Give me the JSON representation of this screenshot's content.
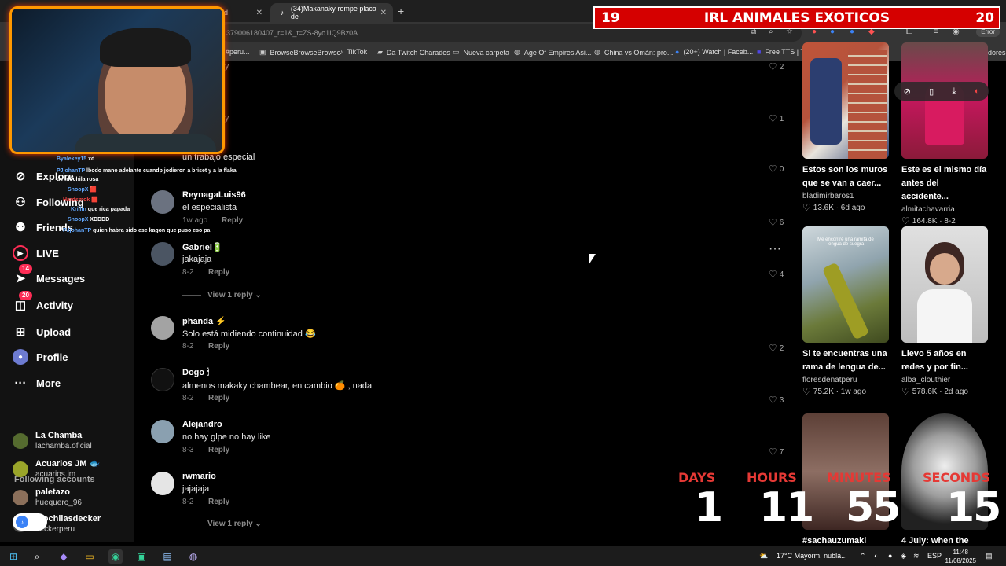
{
  "browser": {
    "tabs": [
      {
        "label": "rld",
        "active": false
      },
      {
        "label": "(34)Makanaky rompe placa de",
        "active": true
      }
    ],
    "url": "379006180407_r=1&_t=ZS-8yo1IQ9Bz0A",
    "error_label": "Error",
    "bookmarks": [
      {
        "label": "#peru...",
        "icon": "folder-icon"
      },
      {
        "label": "BrowseBrowseBrowse",
        "icon": "page-icon"
      },
      {
        "label": "TikTok",
        "icon": "tiktok-icon"
      },
      {
        "label": "Da Twitch Charades",
        "icon": "twitch-icon"
      },
      {
        "label": "Nueva carpeta",
        "icon": "folder-icon"
      },
      {
        "label": "Age Of Empires Asi...",
        "icon": "globe-icon"
      },
      {
        "label": "China vs Omán: pro...",
        "icon": "globe-icon"
      },
      {
        "label": "(20+) Watch | Faceb...",
        "icon": "facebook-icon"
      },
      {
        "label": "Free TTS | Text to Sp...",
        "icon": "page-icon"
      }
    ],
    "all_bookmarks": "Todos los marcadores"
  },
  "sidebar": {
    "nav": [
      {
        "label": "Explore",
        "icon": "compass-icon"
      },
      {
        "label": "Following",
        "icon": "following-icon"
      },
      {
        "label": "Friends",
        "icon": "friends-icon"
      },
      {
        "label": "LIVE",
        "icon": "live-icon"
      },
      {
        "label": "Messages",
        "icon": "messages-icon",
        "badge": "14"
      },
      {
        "label": "Activity",
        "icon": "activity-icon",
        "badge": "20"
      },
      {
        "label": "Upload",
        "icon": "upload-icon"
      },
      {
        "label": "Profile",
        "icon": "profile-icon"
      },
      {
        "label": "More",
        "icon": "more-icon"
      }
    ],
    "following_title": "Following accounts",
    "accounts": [
      {
        "name": "La Chamba",
        "handle": "lachamba.oficial"
      },
      {
        "name": "Acuarios JM 🐟",
        "handle": "acuarios.jm"
      },
      {
        "name": "paletazo",
        "handle": "huequero_96"
      },
      {
        "name": "mochilasdecker",
        "handle": "deckerperu"
      }
    ]
  },
  "comments": {
    "partial_top": [
      {
        "text": "y",
        "likes": "2"
      },
      {
        "text": "y",
        "likes": "1"
      },
      {
        "text": "un trabajo especial",
        "likes": "0"
      }
    ],
    "items": [
      {
        "user": "ReynagaLuis96",
        "text": "el especialista",
        "date": "1w ago",
        "reply": "Reply",
        "likes": "6"
      },
      {
        "user": "Gabriel🔋",
        "text": "jakajaja",
        "date": "8-2",
        "reply": "Reply",
        "likes": "4"
      },
      {
        "user": "phanda ⚡",
        "text": "Solo está midiendo continuidad 😂",
        "date": "8-2",
        "reply": "Reply",
        "likes": "2"
      },
      {
        "user": "Dogo 🕯",
        "text": "almenos makaky chambear, en cambio 🍊 , nada",
        "date": "8-2",
        "reply": "Reply",
        "likes": "3"
      },
      {
        "user": "Alejandro",
        "text": "no hay glpe no hay like",
        "date": "8-3",
        "reply": "Reply",
        "likes": "7"
      },
      {
        "user": "rwmario",
        "text": "jajajaja",
        "date": "8-2",
        "reply": "Reply",
        "likes": ""
      }
    ],
    "view_reply": "View 1 reply"
  },
  "videos": [
    {
      "title": "Estos son los muros que se van a caer...",
      "author": "bladimirbaros1",
      "likes": "13.6K",
      "date": "6d ago"
    },
    {
      "title": "Este es el mismo día antes del accidente...",
      "author": "almitachavarria",
      "likes": "164.8K",
      "date": "8-2"
    },
    {
      "title": "Si te encuentras una rama de lengua de...",
      "author": "floresdenatperu",
      "likes": "75.2K",
      "date": "1w ago",
      "overlay": "Me encontré una ramita de lengua de suegra"
    },
    {
      "title": "Llevo 5 años en redes y por fin...",
      "author": "alba_clouthier",
      "likes": "578.6K",
      "date": "2d ago"
    },
    {
      "title": "#sachauzumaki",
      "author": "",
      "likes": "",
      "date": ""
    },
    {
      "title": "4 July: when the",
      "author": "",
      "likes": "",
      "date": ""
    }
  ],
  "stream_overlay": {
    "banner_left": "19",
    "banner_title": "IRL ANIMALES EXOTICOS",
    "banner_right": "20",
    "chat": [
      {
        "name": "Byalekey15",
        "msg": "xd"
      },
      {
        "name": "PJjohanTP",
        "msg": "lbodo mano adelante cuandp jodieron a briset y a la flaka de mochila rosa"
      },
      {
        "name": "SnoopX",
        "msg": "🟥"
      },
      {
        "name": "Hardsmok",
        "msg": "🟥"
      },
      {
        "name": "Krillin",
        "msg": "que rica papada"
      },
      {
        "name": "SnoopX",
        "msg": "XDDDD"
      },
      {
        "name": "PJjohanTP",
        "msg": "quien habra sido ese kagon que puso eso pa"
      }
    ],
    "countdown": [
      {
        "label": "DAYS",
        "value": "1"
      },
      {
        "label": "HOURS",
        "value": "11"
      },
      {
        "label": "MINUTES",
        "value": "55"
      },
      {
        "label": "SECONDS",
        "value": "15"
      }
    ]
  },
  "taskbar": {
    "weather": "17°C  Mayorm. nubla...",
    "lang": "ESP",
    "time": "11:48",
    "date": "11/08/2025"
  }
}
